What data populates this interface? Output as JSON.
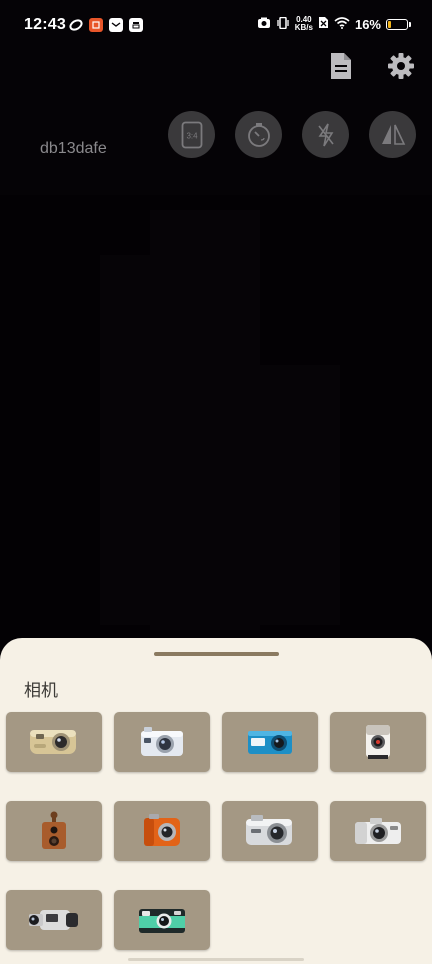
{
  "status_bar": {
    "time": "12:43",
    "net_speed_value": "0.40",
    "net_speed_unit": "KB/s",
    "battery_text": "16%",
    "battery_level": 0.16,
    "battery_color": "#f2b51c",
    "left_icons": [
      "sync-icon",
      "app-badge-icon",
      "mail-icon",
      "inbox-icon"
    ],
    "right_icons": [
      "camera-icon",
      "vibrate-icon",
      "no-sim-icon",
      "wifi-icon",
      "battery-icon"
    ]
  },
  "toolbar": {
    "actions": [
      "document-icon",
      "settings-gear-icon"
    ]
  },
  "controls": {
    "aspect_ratio": "3:4",
    "buttons": [
      "aspect-ratio-button",
      "timer-button",
      "flash-off-button",
      "mirror-button"
    ]
  },
  "device_label": "db13dafe",
  "sheet": {
    "title": "相机",
    "accent_color": "#8a7a60",
    "tile_color": "#a49884",
    "cameras": [
      "compact-gold-camera",
      "silver-digital-camera",
      "blue-compact-camera",
      "instant-white-camera",
      "vintage-brown-camera",
      "orange-toy-camera",
      "silver-zoom-camera",
      "white-bridge-camera",
      "camcorder",
      "disposable-film-camera"
    ]
  }
}
